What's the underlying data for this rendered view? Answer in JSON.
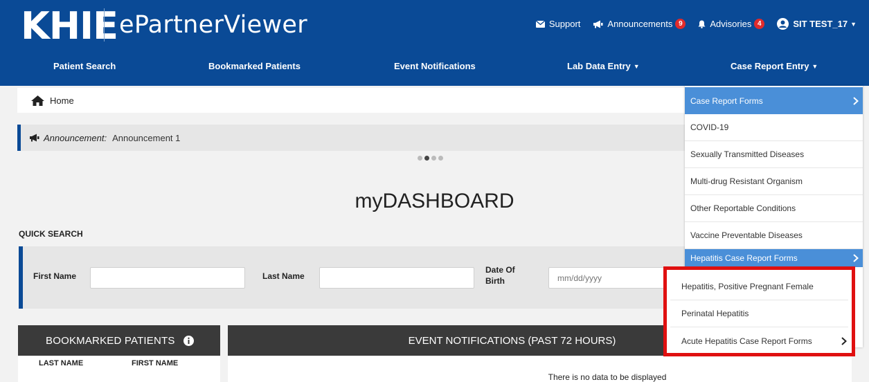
{
  "header": {
    "logo_text": "KHIE",
    "app_title": "ePartnerViewer",
    "support_label": "Support",
    "announcements_label": "Announcements",
    "announcements_count": "9",
    "advisories_label": "Advisories",
    "advisories_count": "4",
    "user_label": "SIT TEST_17"
  },
  "nav": {
    "patient_search": "Patient Search",
    "bookmarked_patients": "Bookmarked Patients",
    "event_notifications": "Event Notifications",
    "lab_data_entry": "Lab Data Entry",
    "case_report_entry": "Case Report Entry"
  },
  "breadcrumb": {
    "home": "Home"
  },
  "announcement": {
    "label": "Announcement:",
    "text": "Announcement 1"
  },
  "dashboard": {
    "title": "myDASHBOARD",
    "quick_search_label": "QUICK SEARCH"
  },
  "search": {
    "first_name_label": "First Name",
    "last_name_label": "Last Name",
    "dob_label_line1": "Date Of",
    "dob_label_line2": "Birth",
    "dob_placeholder": "mm/dd/yyyy"
  },
  "bookmarked_panel": {
    "title": "BOOKMARKED PATIENTS",
    "col_last_name": "LAST NAME",
    "col_first_name": "FIRST NAME"
  },
  "events_panel": {
    "title": "EVENT NOTIFICATIONS (PAST 72 HOURS)",
    "empty_text": "There is no data to be displayed"
  },
  "case_report_menu": {
    "items": [
      "Case Report Forms",
      "COVID-19",
      "Sexually Transmitted Diseases",
      "Multi-drug Resistant Organism",
      "Other Reportable Conditions",
      "Vaccine Preventable Diseases",
      "Hepatitis Case Report Forms"
    ],
    "hepatitis_submenu": [
      "Hepatitis, Positive Pregnant Female",
      "Perinatal Hepatitis",
      "Acute Hepatitis Case Report Forms"
    ]
  },
  "colors": {
    "brand_blue": "#0a4a96",
    "menu_highlight": "#4a8fd8",
    "badge_red": "#e12b2b",
    "annotation_red": "#e01010"
  }
}
